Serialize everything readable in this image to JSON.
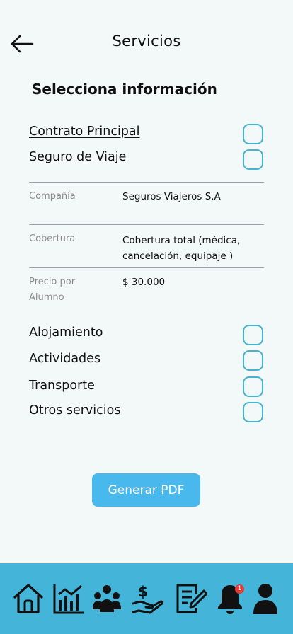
{
  "header": {
    "title": "Servicios",
    "back_icon": "arrow-left-icon"
  },
  "section_title": "Selecciona información",
  "documents": [
    {
      "label": "Contrato Principal",
      "checked": false
    },
    {
      "label": "Seguro de Viaje",
      "checked": false
    }
  ],
  "details": [
    {
      "label": "Compañía",
      "value": "Seguros Viajeros S.A"
    },
    {
      "label": "Cobertura",
      "value": "Cobertura total (médica, cancelación, equipaje )"
    },
    {
      "label": "Precio por Alumno",
      "value": "$ 30.000"
    }
  ],
  "services": [
    {
      "label": "Alojamiento",
      "checked": false
    },
    {
      "label": "Actividades",
      "checked": false
    },
    {
      "label": "Transporte",
      "checked": false
    },
    {
      "label": "Otros servicios",
      "checked": false
    }
  ],
  "generate_button": "Generar PDF",
  "nav": {
    "items": [
      "home-icon",
      "chart-icon",
      "group-icon",
      "payment-icon",
      "document-icon",
      "bell-icon",
      "user-icon"
    ],
    "notification_count": "1"
  },
  "colors": {
    "accent": "#45b4cf",
    "button": "#49b8ec",
    "navbar": "#44b5d8",
    "badge": "#e53935"
  }
}
